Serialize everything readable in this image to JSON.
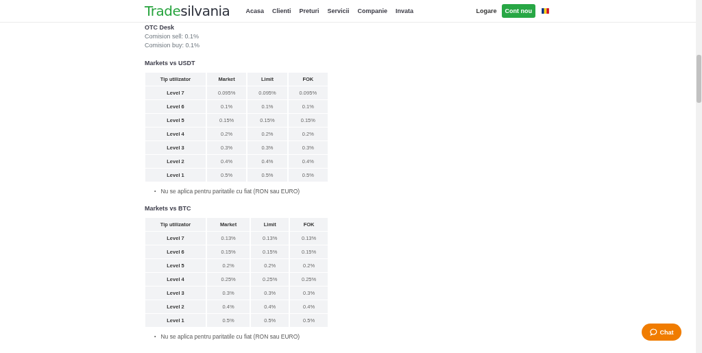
{
  "header": {
    "logo": {
      "part_1": "Trade",
      "part_2": "silvania"
    },
    "nav": [
      "Acasa",
      "Clienti",
      "Preturi",
      "Servicii",
      "Companie",
      "Invata"
    ],
    "login": "Logare",
    "signup": "Cont nou"
  },
  "otc": {
    "title": "OTC Desk",
    "lines": [
      "Comision sell: 0.1%",
      "Comision buy: 0.1%"
    ]
  },
  "sections": [
    {
      "title": "Markets vs USDT",
      "table": {
        "columns": [
          "Tip utilizator",
          "Market",
          "Limit",
          "FOK"
        ],
        "rows": [
          [
            "Level 7",
            "0.095%",
            "0.095%",
            "0.095%"
          ],
          [
            "Level 6",
            "0.1%",
            "0.1%",
            "0.1%"
          ],
          [
            "Level 5",
            "0.15%",
            "0.15%",
            "0.15%"
          ],
          [
            "Level 4",
            "0.2%",
            "0.2%",
            "0.2%"
          ],
          [
            "Level 3",
            "0.3%",
            "0.3%",
            "0.3%"
          ],
          [
            "Level 2",
            "0.4%",
            "0.4%",
            "0.4%"
          ],
          [
            "Level 1",
            "0.5%",
            "0.5%",
            "0.5%"
          ]
        ]
      },
      "bullet": "•",
      "note": "Nu se aplica pentru paritatile cu fiat (RON sau EURO)"
    },
    {
      "title": "Markets vs BTC",
      "table": {
        "columns": [
          "Tip utilizator",
          "Market",
          "Limit",
          "FOK"
        ],
        "rows": [
          [
            "Level 7",
            "0.13%",
            "0.13%",
            "0.13%"
          ],
          [
            "Level 6",
            "0.15%",
            "0.15%",
            "0.15%"
          ],
          [
            "Level 5",
            "0.2%",
            "0.2%",
            "0.2%"
          ],
          [
            "Level 4",
            "0.25%",
            "0.25%",
            "0.25%"
          ],
          [
            "Level 3",
            "0.3%",
            "0.3%",
            "0.3%"
          ],
          [
            "Level 2",
            "0.4%",
            "0.4%",
            "0.4%"
          ],
          [
            "Level 1",
            "0.5%",
            "0.5%",
            "0.5%"
          ]
        ]
      },
      "bullet": "•",
      "note": "Nu se aplica pentru paritatile cu fiat (RON sau EURO)"
    }
  ],
  "chat": {
    "label": "Chat"
  }
}
